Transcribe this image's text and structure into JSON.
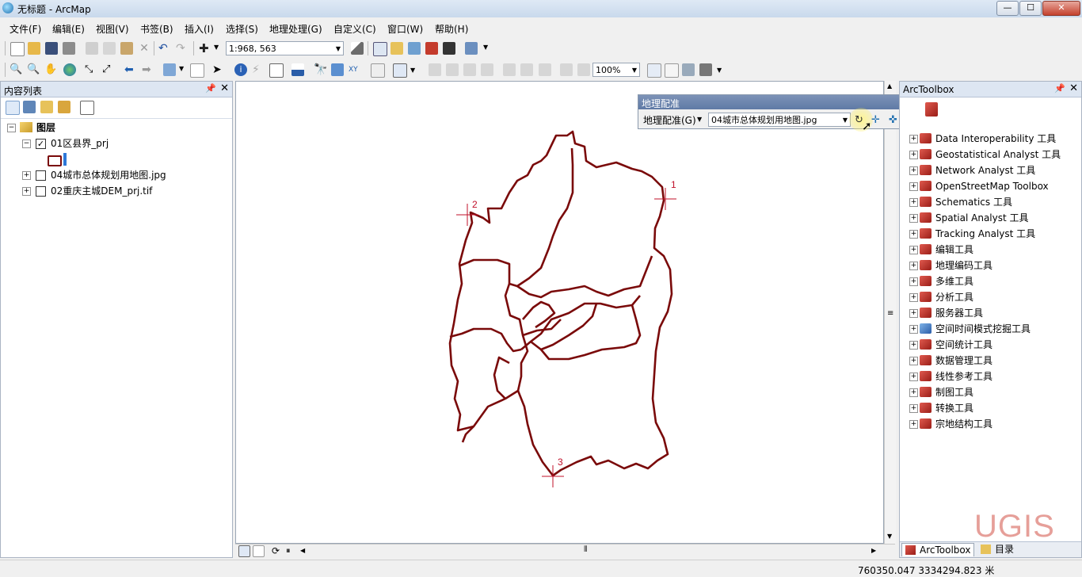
{
  "window": {
    "title": "无标题 - ArcMap",
    "controls": {
      "minimize": "—",
      "maximize": "☐",
      "close": "✕"
    }
  },
  "menu": [
    "文件(F)",
    "编辑(E)",
    "视图(V)",
    "书签(B)",
    "插入(I)",
    "选择(S)",
    "地理处理(G)",
    "自定义(C)",
    "窗口(W)",
    "帮助(H)"
  ],
  "toolbar": {
    "scale_value": "1:968, 563",
    "zoom_value": "100%"
  },
  "toc": {
    "title": "内容列表",
    "root": "图层",
    "layers": [
      {
        "name": "01区县界_prj",
        "checked": true,
        "expanded": true
      },
      {
        "name": "04城市总体规划用地图.jpg",
        "checked": false,
        "expanded": false
      },
      {
        "name": "02重庆主城DEM_prj.tif",
        "checked": false,
        "expanded": false
      }
    ],
    "check_mark": "✓"
  },
  "georef": {
    "title": "地理配准",
    "menu_label": "地理配准(G)",
    "layer_value": "04城市总体规划用地图.jpg"
  },
  "map": {
    "control_points": [
      "1",
      "2",
      "3"
    ]
  },
  "arctoolbox": {
    "title": "ArcToolbox",
    "tools": [
      "Data Interoperability 工具",
      "Geostatistical Analyst 工具",
      "Network Analyst 工具",
      "OpenStreetMap Toolbox",
      "Schematics 工具",
      "Spatial Analyst 工具",
      "Tracking Analyst 工具",
      "编辑工具",
      "地理编码工具",
      "多维工具",
      "分析工具",
      "服务器工具",
      "空间时间模式挖掘工具",
      "空间统计工具",
      "数据管理工具",
      "线性参考工具",
      "制图工具",
      "转换工具",
      "宗地结构工具"
    ],
    "tabs": [
      "ArcToolbox",
      "目录"
    ]
  },
  "status": {
    "coordinates": "760350.047  3334294.823 米"
  },
  "watermark": {
    "text": "UGIS"
  },
  "colors": {
    "boundary": "#7a0a0a",
    "control_point": "#c0102a"
  }
}
